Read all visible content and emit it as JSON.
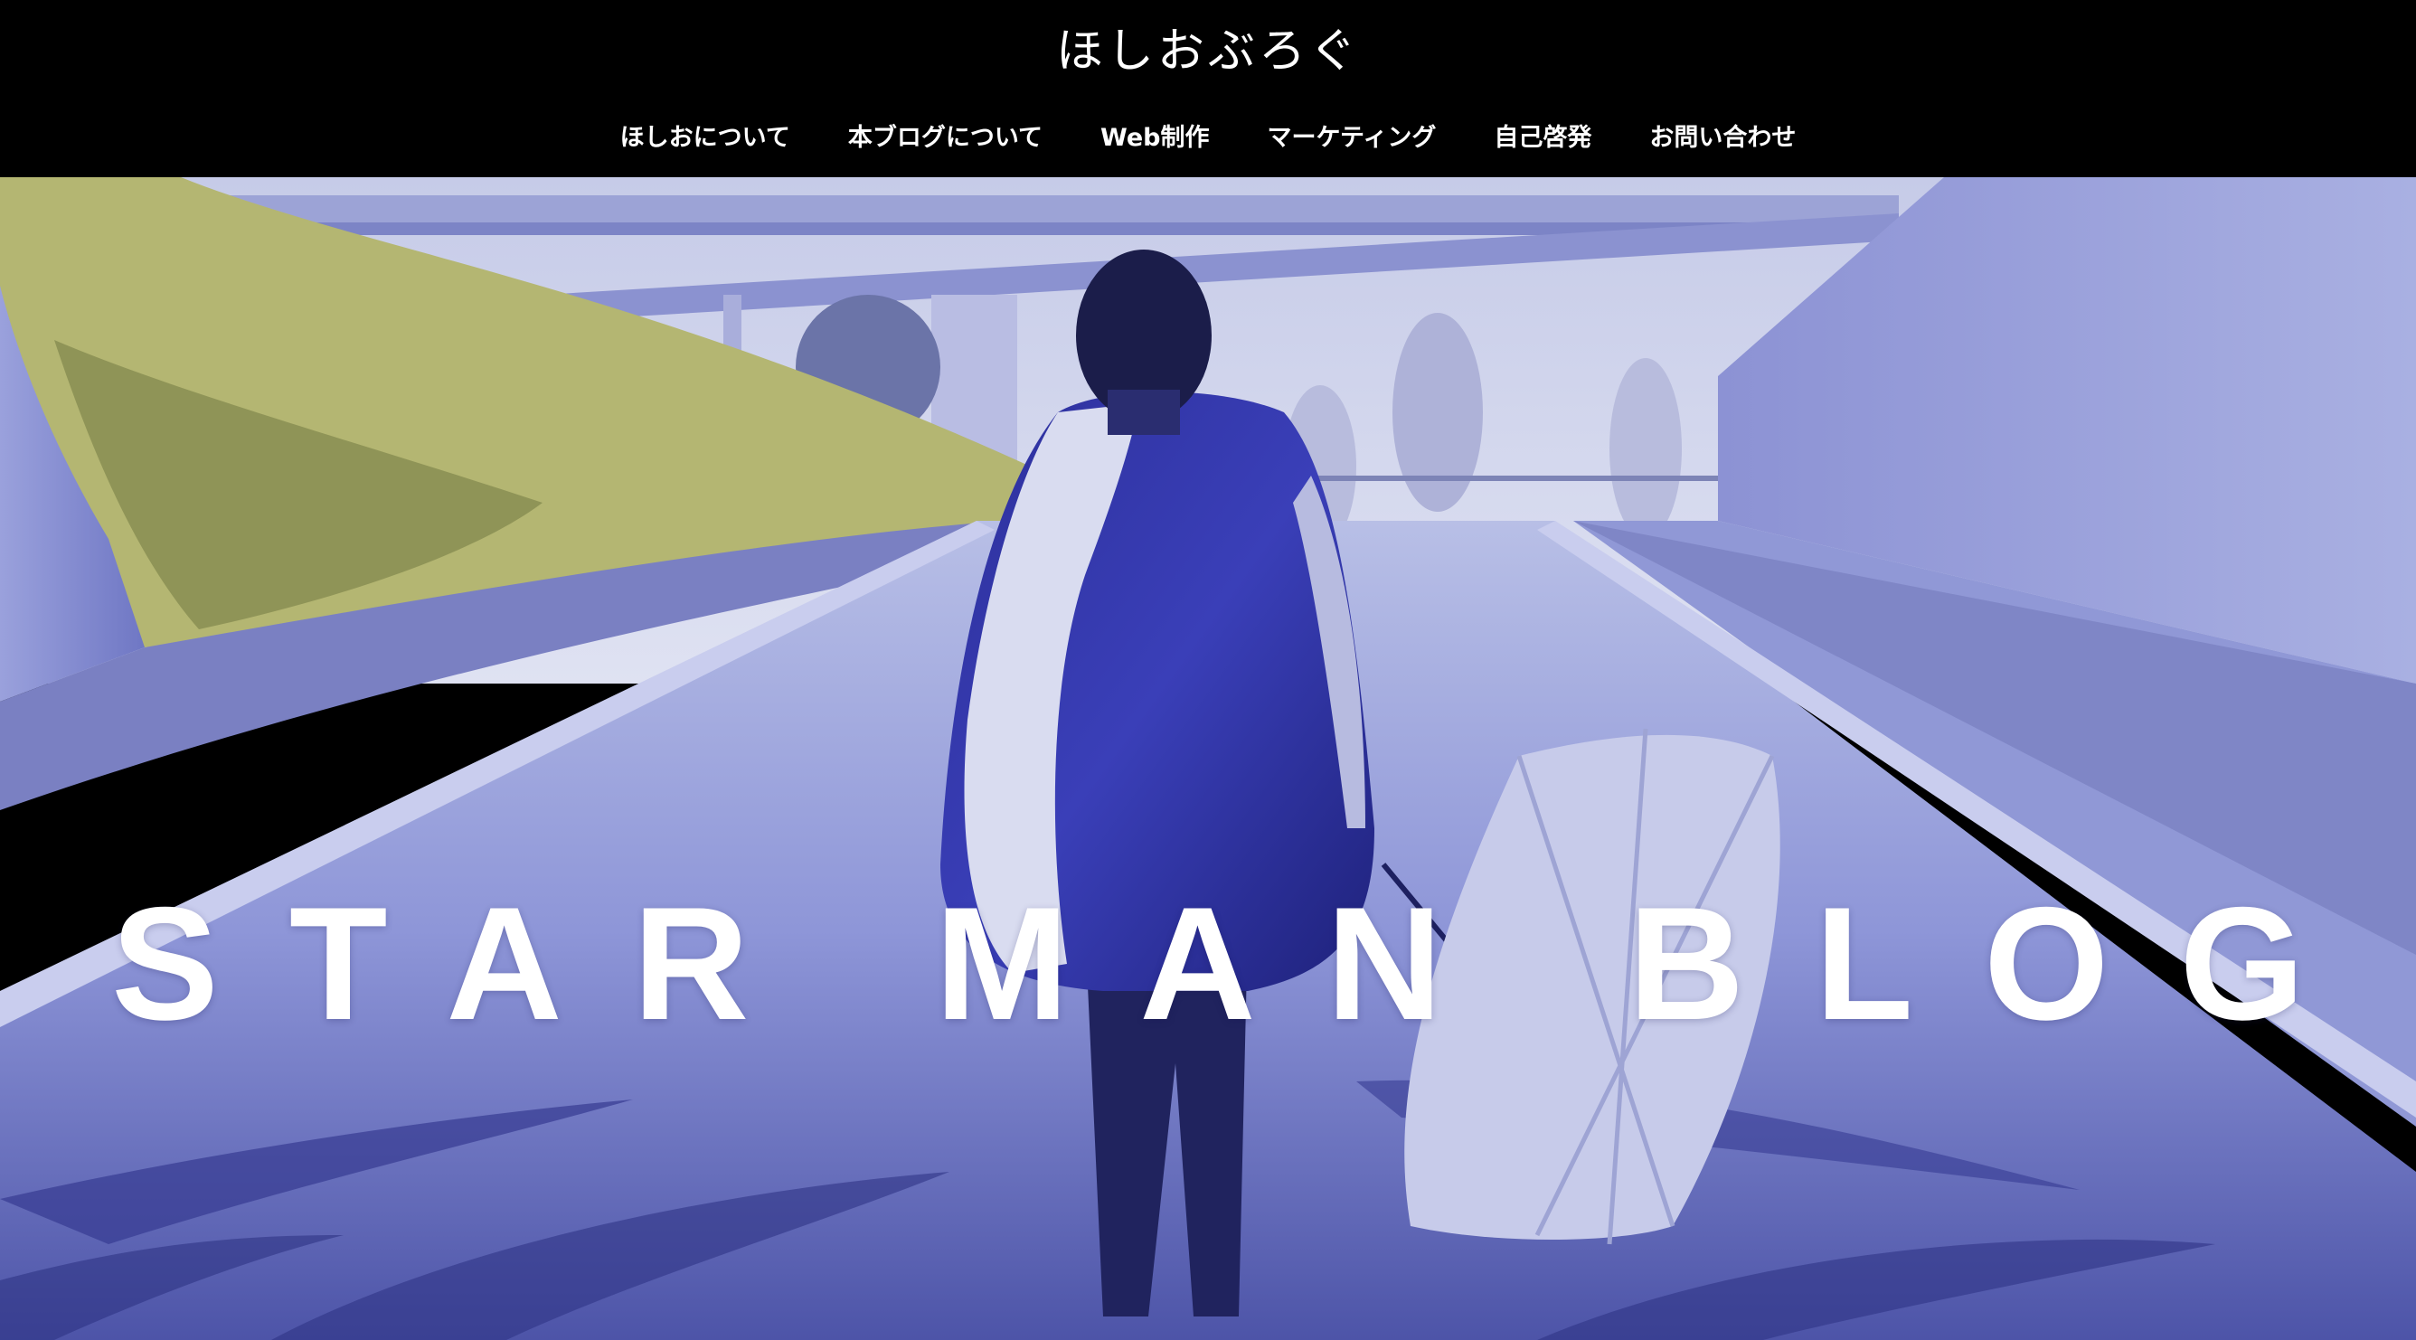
{
  "site": {
    "title": "ほしおぶろぐ"
  },
  "nav": {
    "items": [
      {
        "label": "ほしおについて"
      },
      {
        "label": "本ブログについて"
      },
      {
        "label": "Web制作"
      },
      {
        "label": "マーケティング"
      },
      {
        "label": "自己啓発"
      },
      {
        "label": "お問い合わせ"
      }
    ]
  },
  "hero": {
    "title": "STAR MAN BLOG",
    "image": "hero-photo-man-with-umbrella",
    "tint": "#5a62c8"
  },
  "colors": {
    "header_bg": "#000000",
    "header_text": "#ffffff"
  }
}
